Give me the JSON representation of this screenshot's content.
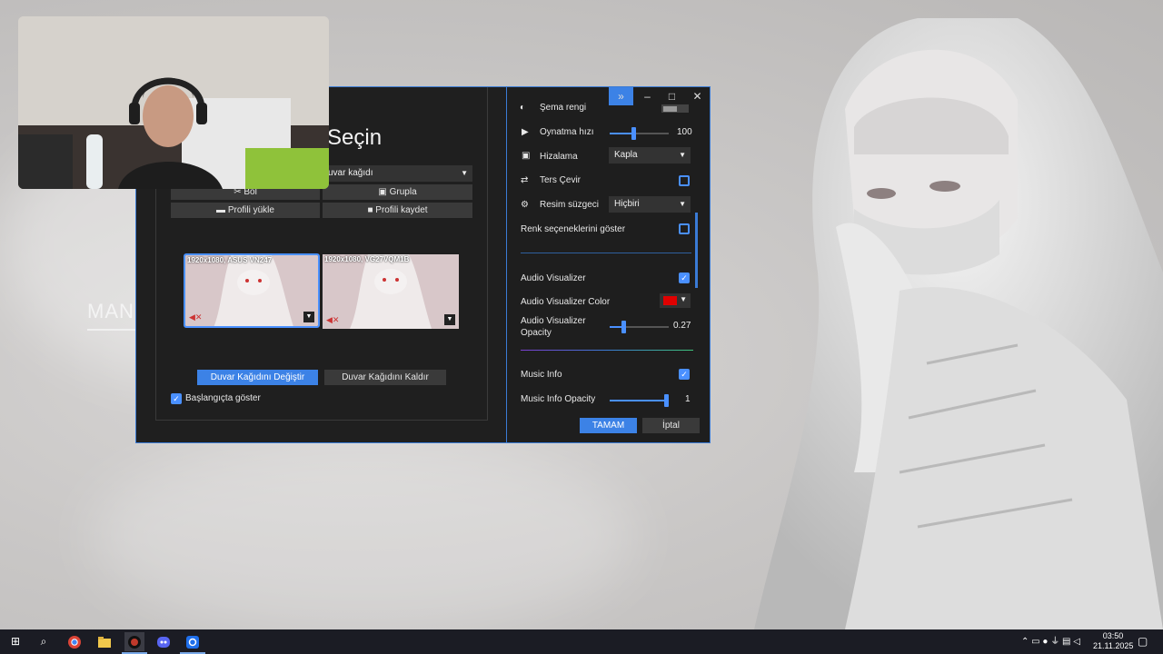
{
  "desktop": {
    "text": "MAN"
  },
  "dialog": {
    "title": "Seçin",
    "wallpaper_select": "uvar kağıdı",
    "buttons": {
      "split": "Böl",
      "group": "Grupla",
      "load_profile": "Profili yükle",
      "save_profile": "Profili kaydet",
      "change_wallpaper": "Duvar Kağıdını Değiştir",
      "remove_wallpaper": "Duvar Kağıdını Kaldır"
    },
    "monitors": [
      {
        "label": "1920x1080, ASUS VN247"
      },
      {
        "label": "1920x1080, VG27VQM1B"
      }
    ],
    "show_at_startup": {
      "label": "Başlangıçta göster",
      "checked": true
    }
  },
  "settings": {
    "scheme_color": {
      "label": "Şema rengi",
      "value": "#9a9a9a"
    },
    "playback_speed": {
      "label": "Oynatma hızı",
      "value": "100",
      "fraction": 0.45
    },
    "alignment": {
      "label": "Hizalama",
      "value": "Kapla"
    },
    "flip": {
      "label": "Ters Çevir",
      "checked": false
    },
    "image_filter": {
      "label": "Resim süzgeci",
      "value": "Hiçbiri"
    },
    "show_color_options": {
      "label": "Renk seçeneklerini göster",
      "checked": false
    },
    "audio_visualizer": {
      "label": "Audio Visualizer",
      "checked": true
    },
    "audio_visualizer_color": {
      "label": "Audio Visualizer Color",
      "value": "#e00000"
    },
    "audio_visualizer_opacity": {
      "label": "Audio Visualizer Opacity",
      "value": "0.27",
      "fraction": 0.27
    },
    "music_info": {
      "label": "Music Info",
      "checked": true
    },
    "music_info_opacity": {
      "label": "Music Info Opacity",
      "value": "1",
      "fraction": 1.0
    },
    "ok": "TAMAM",
    "cancel": "İptal"
  },
  "colors": {
    "accent": "#3c82e6",
    "panel": "#1f1f1f",
    "taskbar": "#1b1c24"
  },
  "taskbar": {
    "icons": [
      "windows-start-icon",
      "search-icon",
      "chrome-icon",
      "file-explorer-icon",
      "app-icon",
      "discord-icon",
      "wallpaper-app-icon"
    ],
    "time": "03:50",
    "date": "21.11.2025"
  }
}
